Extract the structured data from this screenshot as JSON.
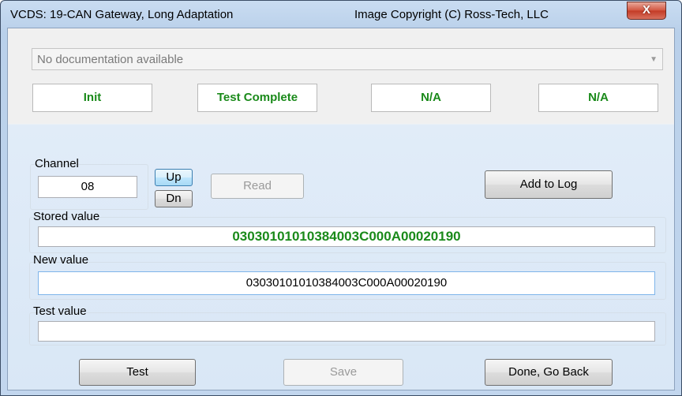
{
  "window": {
    "title_left": "VCDS: 19-CAN Gateway,  Long Adaptation",
    "title_right": "Image Copyright (C) Ross-Tech, LLC",
    "close_glyph": "X"
  },
  "doc_select": {
    "value": "No documentation available",
    "arrow_icon": "chevron-down-icon"
  },
  "status_fields": [
    "Init",
    "Test Complete",
    "N/A",
    "N/A"
  ],
  "channel": {
    "label": "Channel",
    "value": "08",
    "up_label": "Up",
    "down_label": "Dn"
  },
  "buttons": {
    "read": "Read",
    "add_to_log": "Add to Log",
    "test": "Test",
    "save": "Save",
    "done": "Done, Go Back"
  },
  "stored": {
    "label": "Stored value",
    "value": "03030101010384003C000A00020190"
  },
  "new": {
    "label": "New value",
    "value": "03030101010384003C000A00020190"
  },
  "test": {
    "label": "Test value",
    "value": ""
  },
  "colors": {
    "status_text": "#1a8a1a",
    "stored_text": "#1a8a1a"
  }
}
